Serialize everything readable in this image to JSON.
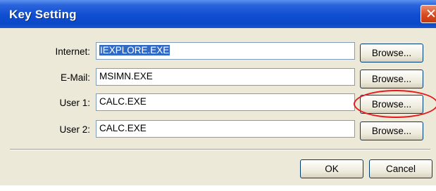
{
  "window": {
    "title": "Key Setting",
    "close_icon": "close-icon"
  },
  "rows": [
    {
      "label": "Internet:",
      "value": "IEXPLORE.EXE",
      "selected": true,
      "button": "Browse..."
    },
    {
      "label": "E-Mail:",
      "value": "MSIMN.EXE",
      "selected": false,
      "button": "Browse..."
    },
    {
      "label": "User 1:",
      "value": "CALC.EXE",
      "selected": false,
      "button": "Browse..."
    },
    {
      "label": "User 2:",
      "value": "CALC.EXE",
      "selected": false,
      "button": "Browse..."
    }
  ],
  "footer": {
    "ok_label": "OK",
    "cancel_label": "Cancel"
  },
  "colors": {
    "titlebar": "#0b48c6",
    "client_bg": "#ece9d8",
    "selection": "#316ac5",
    "annotation": "#e8161b"
  },
  "annotation": {
    "highlighted_button": "User 1 Browse..."
  }
}
